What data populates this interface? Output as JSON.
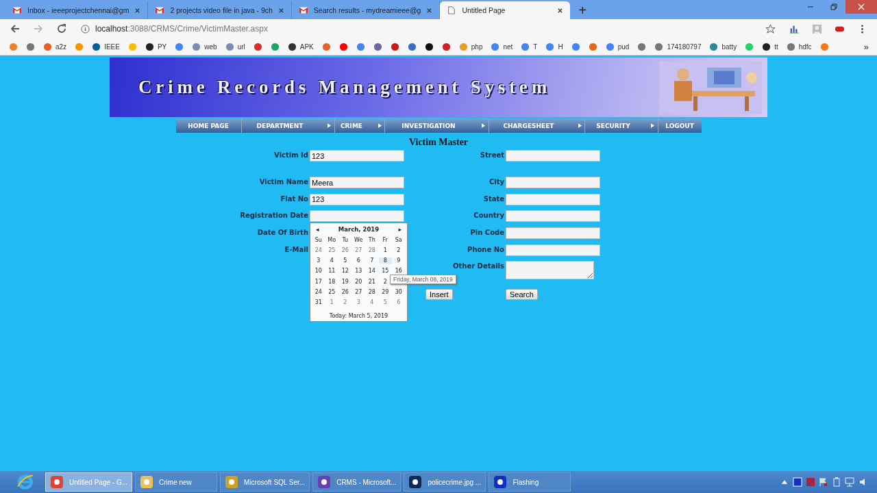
{
  "browser": {
    "tabs": [
      {
        "title": "Inbox - ieeeprojectchennai@gm",
        "kind": "mail",
        "selected": false
      },
      {
        "title": "2 projects video file in java - 9ch",
        "kind": "mail",
        "selected": false
      },
      {
        "title": "Search results - mydreamieee@g",
        "kind": "mail",
        "selected": false
      },
      {
        "title": "Untitled Page",
        "kind": "page",
        "selected": true
      }
    ],
    "new_tab": "+",
    "url_host": "localhost",
    "url_path": ":3088/CRMS/Crime/VictimMaster.aspx",
    "bookmarks": [
      {
        "color": "#e8832a"
      },
      {
        "color": "#777777"
      },
      {
        "label": "a2z",
        "color": "#e8632a"
      },
      {
        "color": "#f29900"
      },
      {
        "label": "IEEE",
        "color": "#00629b"
      },
      {
        "color": "#fbbc04"
      },
      {
        "label": "PY",
        "color": "#222222"
      },
      {
        "color": "#4285f4"
      },
      {
        "label": "web",
        "color": "#7a8fb0"
      },
      {
        "label": "url",
        "color": "#7a8fb0"
      },
      {
        "color": "#d93025"
      },
      {
        "color": "#1fa463"
      },
      {
        "label": "APK",
        "color": "#333333"
      },
      {
        "color": "#e8632a"
      },
      {
        "color": "#ff0000"
      },
      {
        "color": "#4285f4"
      },
      {
        "color": "#6a6aa0"
      },
      {
        "color": "#cc1a1a"
      },
      {
        "color": "#3a6fc4"
      },
      {
        "color": "#111111"
      },
      {
        "color": "#cc2222"
      },
      {
        "label": "php",
        "color": "#e8a020"
      },
      {
        "label": "net",
        "color": "#4285f4"
      },
      {
        "label": "T",
        "color": "#4285f4"
      },
      {
        "label": "H",
        "color": "#4285f4"
      },
      {
        "color": "#4285f4"
      },
      {
        "color": "#e06a1a"
      },
      {
        "label": "pud",
        "color": "#4285f4"
      },
      {
        "color": "#777777"
      },
      {
        "label": "174180797",
        "color": "#777777"
      },
      {
        "label": "batty",
        "color": "#2a8a9a"
      },
      {
        "color": "#25d366"
      },
      {
        "label": "tt",
        "color": "#222222"
      },
      {
        "label": "hdfc",
        "color": "#777777"
      },
      {
        "color": "#f07a1a"
      }
    ],
    "more_bookmarks": "»"
  },
  "header": {
    "title": "Crime Records Management System"
  },
  "nav": [
    {
      "label": "HOME PAGE",
      "submenu": false
    },
    {
      "label": "DEPARTMENT",
      "submenu": true
    },
    {
      "label": "CRIME",
      "submenu": true
    },
    {
      "label": "INVESTIGATION",
      "submenu": true
    },
    {
      "label": "CHARGESHEET",
      "submenu": true
    },
    {
      "label": "SECURITY",
      "submenu": true
    },
    {
      "label": "LOGOUT",
      "submenu": false
    }
  ],
  "form": {
    "title": "Victim Master",
    "left": [
      {
        "label": "Victim Id",
        "value": "123",
        "kind": "input"
      },
      {
        "label": "Victim Name",
        "value": "Meera",
        "kind": "input"
      },
      {
        "label": "Flat No",
        "value": "123",
        "kind": "input"
      },
      {
        "label": "Registration Date",
        "kind": "date"
      },
      {
        "label": "Date Of Birth",
        "kind": "covered"
      },
      {
        "label": "E-Mail",
        "kind": "covered"
      }
    ],
    "right": [
      {
        "label": "Street",
        "kind": "input"
      },
      {
        "label": "City",
        "kind": "input"
      },
      {
        "label": "State",
        "kind": "input"
      },
      {
        "label": "Country",
        "kind": "input"
      },
      {
        "label": "Pin Code",
        "kind": "input"
      },
      {
        "label": "Phone No",
        "kind": "input"
      },
      {
        "label": "Other Details",
        "kind": "textarea"
      }
    ],
    "buttons": [
      "Insert",
      "Search"
    ]
  },
  "calendar": {
    "prev": "◂",
    "next": "▸",
    "month": "March, 2019",
    "weekdays": [
      "Su",
      "Mo",
      "Tu",
      "We",
      "Th",
      "Fr",
      "Sa"
    ],
    "weeks": [
      [
        {
          "d": "24",
          "muted": true,
          "hovered": false
        },
        {
          "d": "25",
          "muted": true,
          "hovered": false
        },
        {
          "d": "26",
          "muted": true,
          "hovered": false
        },
        {
          "d": "27",
          "muted": true,
          "hovered": false
        },
        {
          "d": "28",
          "muted": true,
          "hovered": false
        },
        {
          "d": "1",
          "muted": false,
          "hovered": false
        },
        {
          "d": "2",
          "muted": false,
          "hovered": false
        }
      ],
      [
        {
          "d": "3",
          "muted": false,
          "hovered": false
        },
        {
          "d": "4",
          "muted": false,
          "hovered": false
        },
        {
          "d": "5",
          "muted": false,
          "hovered": false
        },
        {
          "d": "6",
          "muted": false,
          "hovered": false
        },
        {
          "d": "7",
          "muted": false,
          "hovered": false
        },
        {
          "d": "8",
          "muted": false,
          "hovered": true
        },
        {
          "d": "9",
          "muted": false,
          "hovered": false
        }
      ],
      [
        {
          "d": "10",
          "muted": false,
          "hovered": false
        },
        {
          "d": "11",
          "muted": false,
          "hovered": false
        },
        {
          "d": "12",
          "muted": false,
          "hovered": false
        },
        {
          "d": "13",
          "muted": false,
          "hovered": false
        },
        {
          "d": "14",
          "muted": false,
          "hovered": false
        },
        {
          "d": "15",
          "muted": false,
          "hovered": false
        },
        {
          "d": "16",
          "muted": false,
          "hovered": false
        }
      ],
      [
        {
          "d": "17",
          "muted": false,
          "hovered": false
        },
        {
          "d": "18",
          "muted": false,
          "hovered": false
        },
        {
          "d": "19",
          "muted": false,
          "hovered": false
        },
        {
          "d": "20",
          "muted": false,
          "hovered": false
        },
        {
          "d": "21",
          "muted": false,
          "hovered": false
        },
        {
          "d": "2",
          "muted": false,
          "hovered": false
        }
      ],
      [
        {
          "d": "24",
          "muted": false,
          "hovered": false
        },
        {
          "d": "25",
          "muted": false,
          "hovered": false
        },
        {
          "d": "26",
          "muted": false,
          "hovered": false
        },
        {
          "d": "27",
          "muted": false,
          "hovered": false
        },
        {
          "d": "28",
          "muted": false,
          "hovered": false
        },
        {
          "d": "29",
          "muted": false,
          "hovered": false
        },
        {
          "d": "30",
          "muted": false,
          "hovered": false
        }
      ],
      [
        {
          "d": "31",
          "muted": false,
          "hovered": false
        },
        {
          "d": "1",
          "muted": true,
          "hovered": false
        },
        {
          "d": "2",
          "muted": true,
          "hovered": false
        },
        {
          "d": "3",
          "muted": true,
          "hovered": false
        },
        {
          "d": "4",
          "muted": true,
          "hovered": false
        },
        {
          "d": "5",
          "muted": true,
          "hovered": false
        },
        {
          "d": "6",
          "muted": true,
          "hovered": false
        }
      ]
    ],
    "today": "Today: March 5, 2019",
    "tooltip": "Friday, March 08, 2019"
  },
  "taskbar": {
    "items": [
      {
        "label": "Untitled Page - G...",
        "kind": "chrome",
        "selected": true
      },
      {
        "label": "Crime new",
        "kind": "folder",
        "selected": false
      },
      {
        "label": "Microsoft SQL Ser...",
        "kind": "sql",
        "selected": false
      },
      {
        "label": "CRMS - Microsoft...",
        "kind": "vs",
        "selected": false
      },
      {
        "label": "policecrime.jpg ...",
        "kind": "ps",
        "selected": false
      },
      {
        "label": "Flashing",
        "kind": "app",
        "selected": false
      }
    ]
  }
}
